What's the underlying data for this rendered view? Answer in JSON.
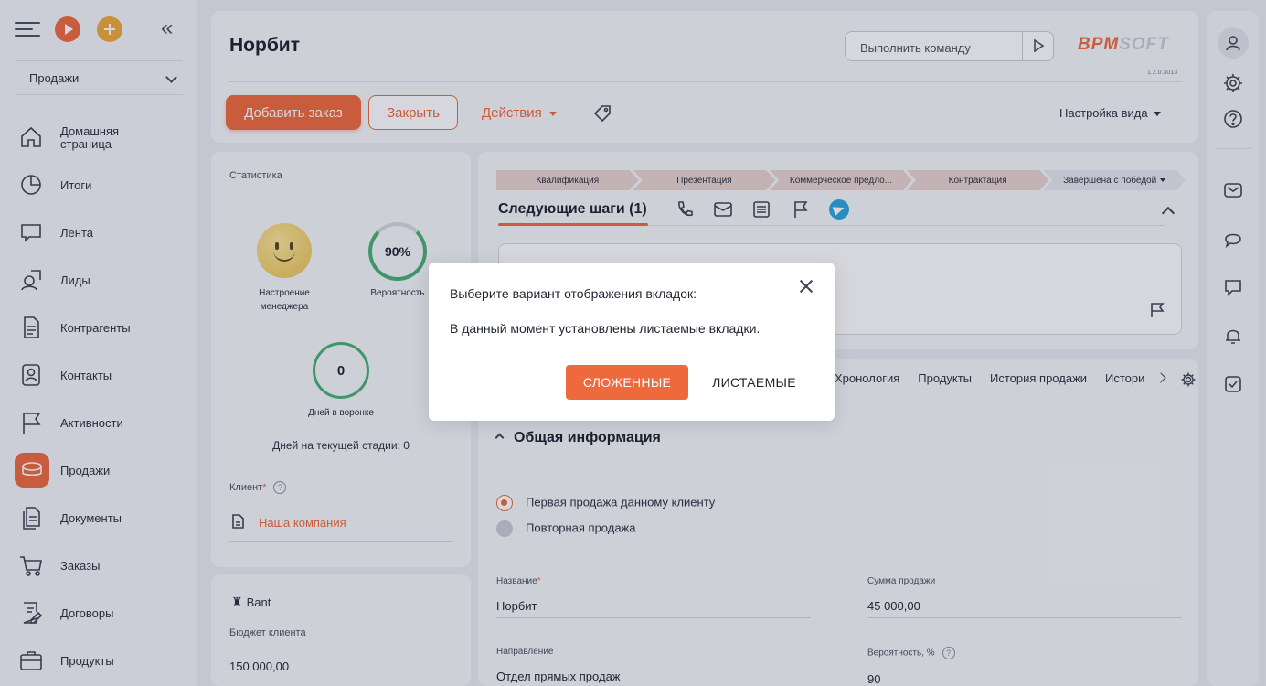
{
  "sidebar": {
    "workspace": "Продажи",
    "items": [
      {
        "label": "Домашняя страница",
        "icon": "home-icon"
      },
      {
        "label": "Итоги",
        "icon": "pie-chart-icon"
      },
      {
        "label": "Лента",
        "icon": "chat-bubble-icon"
      },
      {
        "label": "Лиды",
        "icon": "leads-icon"
      },
      {
        "label": "Контрагенты",
        "icon": "document-icon"
      },
      {
        "label": "Контакты",
        "icon": "contact-card-icon"
      },
      {
        "label": "Активности",
        "icon": "flag-icon"
      },
      {
        "label": "Продажи",
        "icon": "coins-icon",
        "active": true
      },
      {
        "label": "Документы",
        "icon": "documents-icon"
      },
      {
        "label": "Заказы",
        "icon": "cart-icon"
      },
      {
        "label": "Договоры",
        "icon": "contract-icon"
      },
      {
        "label": "Продукты",
        "icon": "box-icon"
      }
    ]
  },
  "header": {
    "title": "Норбит",
    "command_placeholder": "Выполнить команду",
    "brand_left": "BPM",
    "brand_right": "SOFT",
    "version": "1.2.0.3013",
    "add_order": "Добавить заказ",
    "close": "Закрыть",
    "actions": "Действия",
    "view_settings": "Настройка вида"
  },
  "stats": {
    "section": "Статистика",
    "mood_caption": "Настроение менеджера",
    "probability_value": "90%",
    "probability_caption": "Вероятность",
    "days_value": "0",
    "days_caption": "Дней в воронке",
    "days_stage": "Дней на текущей стадии: 0",
    "client_label": "Клиент",
    "client_value": "Наша компания"
  },
  "bant": {
    "title": "Bant",
    "budget_label": "Бюджет клиента",
    "budget_value": "150 000,00"
  },
  "stages": [
    "Квалификация",
    "Презентация",
    "Коммерческое предло...",
    "Контрактация",
    "Завершена с победой"
  ],
  "next_steps": {
    "title": "Следующие шаги (1)"
  },
  "tabs": [
    "Хронология",
    "Продукты",
    "История продажи",
    "Истори"
  ],
  "general": {
    "title": "Общая информация",
    "radio_first": "Первая продажа данному клиенту",
    "radio_repeat": "Повторная продажа",
    "name_label": "Название",
    "name_value": "Норбит",
    "sum_label": "Сумма продажи",
    "sum_value": "45 000,00",
    "direction_label": "Направление",
    "direction_value": "Отдел прямых продаж",
    "prob_label": "Вероятность, %",
    "prob_value": "90"
  },
  "modal": {
    "title": "Выберите вариант отображения вкладок:",
    "body": "В данный момент установлены листаемые вкладки.",
    "btn_folded": "СЛОЖЕННЫЕ",
    "btn_scrollable": "ЛИСТАЕМЫЕ"
  },
  "colors": {
    "accent": "#ee6a3c",
    "success": "#4ab073",
    "telegram": "#2ea5df"
  }
}
